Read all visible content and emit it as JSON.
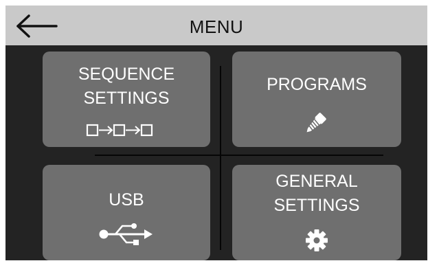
{
  "header": {
    "title": "MENU",
    "back_icon": "arrow-left-icon"
  },
  "tiles": [
    {
      "line1": "SEQUENCE",
      "line2": "SETTINGS",
      "icon": "sequence-boxes-icon"
    },
    {
      "line1": "PROGRAMS",
      "icon": "screw-icon"
    },
    {
      "line1": "USB",
      "icon": "usb-icon"
    },
    {
      "line1": "GENERAL",
      "line2": "SETTINGS",
      "icon": "gear-icon"
    }
  ],
  "colors": {
    "header_bg": "#c9c9c9",
    "screen_bg": "#232323",
    "tile_bg": "#6f6f6f",
    "text_light": "#ffffff",
    "text_dark": "#111111"
  }
}
